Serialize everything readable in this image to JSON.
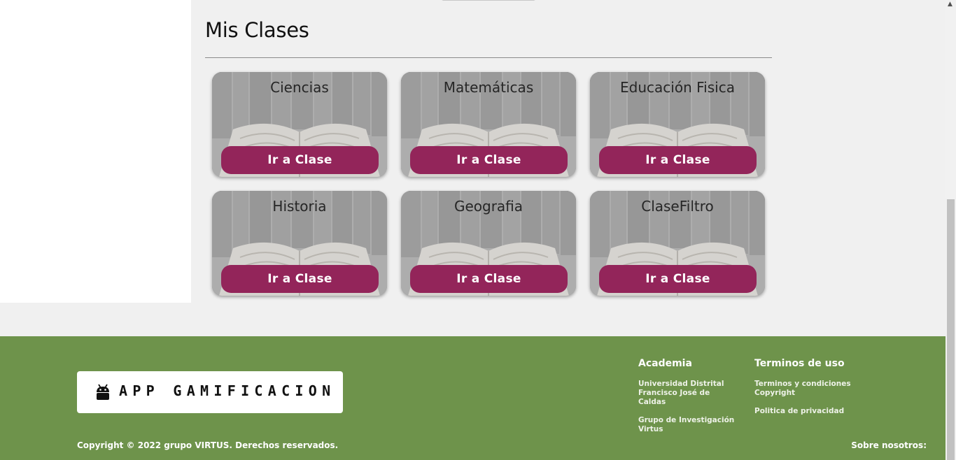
{
  "main": {
    "title": "Mis Clases"
  },
  "classes": [
    {
      "name": "Ciencias",
      "button": "Ir a Clase"
    },
    {
      "name": "Matemáticas",
      "button": "Ir a Clase"
    },
    {
      "name": "Educación Fisica",
      "button": "Ir a Clase"
    },
    {
      "name": "Historia",
      "button": "Ir a Clase"
    },
    {
      "name": "Geografia",
      "button": "Ir a Clase"
    },
    {
      "name": "ClaseFiltro",
      "button": "Ir a Clase"
    }
  ],
  "footer": {
    "logo_text": "APP GAMIFICACION",
    "logo_icon": "android-icon",
    "academia": {
      "heading": "Academia",
      "links": [
        "Universidad Distrital Francisco José de Caldas",
        "Grupo de Investigación Virtus"
      ]
    },
    "terminos": {
      "heading": "Terminos de uso",
      "links": [
        "Terminos y condiciones Copyright",
        "Politica de privacidad"
      ]
    },
    "copyright": "Copyright © 2022 grupo VIRTUS. Derechos reservados.",
    "about": "Sobre nosotros:"
  },
  "colors": {
    "button": "#93255a",
    "footer": "#6e934b",
    "background": "#f0f0f0"
  }
}
